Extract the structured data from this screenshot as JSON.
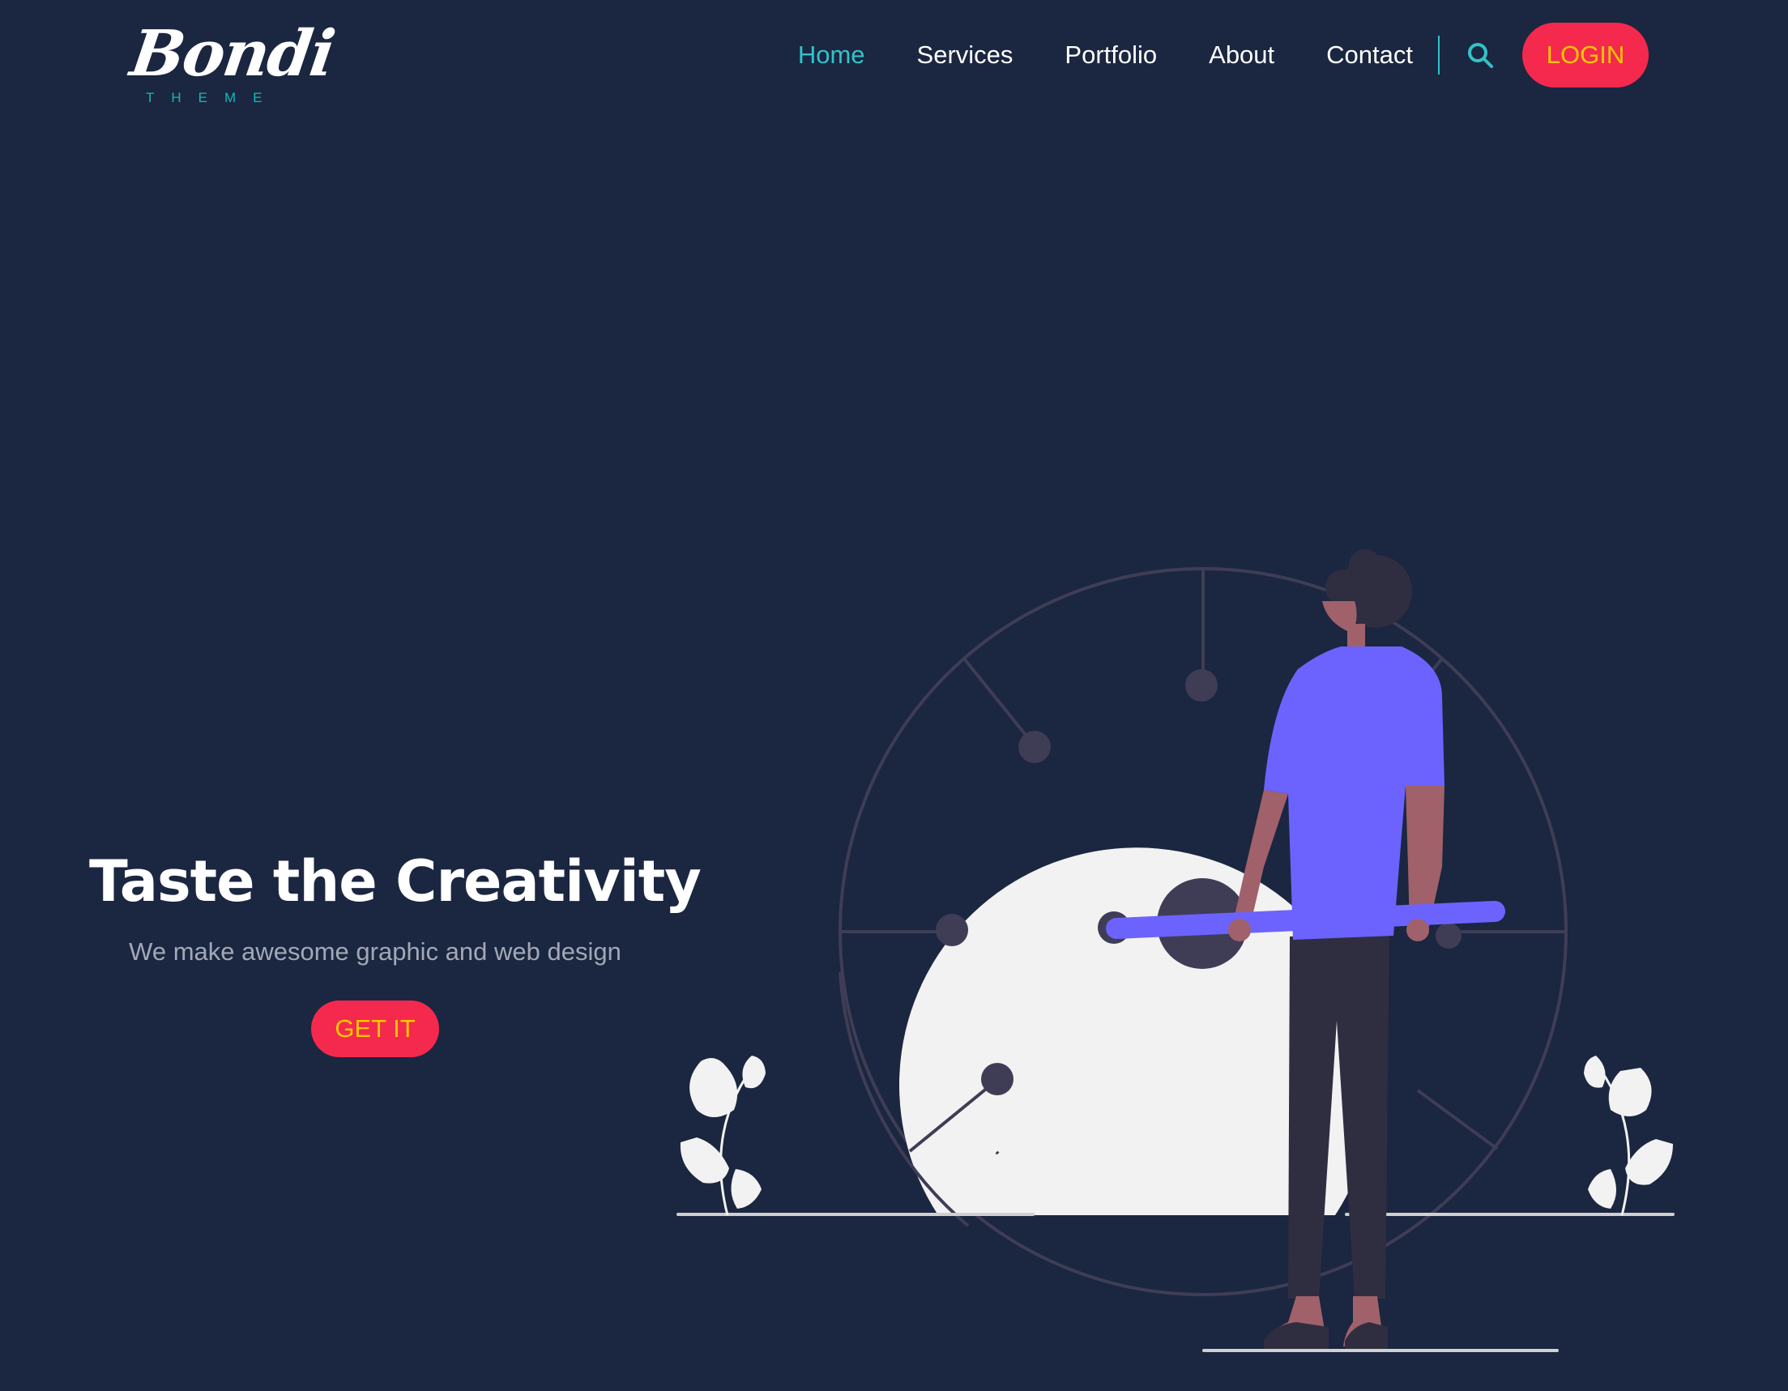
{
  "brand": {
    "logo_text": "Bondi",
    "logo_sub": "THEME",
    "logo_color": "#ffffff",
    "accent_color": "#31c3c9"
  },
  "nav": {
    "items": [
      {
        "label": "Home",
        "active": true
      },
      {
        "label": "Services",
        "active": false
      },
      {
        "label": "Portfolio",
        "active": false
      },
      {
        "label": "About",
        "active": false
      },
      {
        "label": "Contact",
        "active": false
      }
    ],
    "search_icon": "search-icon",
    "login_label": "LOGIN"
  },
  "hero": {
    "title": "Taste the Creativity",
    "subtitle": "We make awesome graphic and web design",
    "cta_label": "GET IT"
  },
  "colors": {
    "background": "#1b2640",
    "cta_background": "#f5294e",
    "cta_text": "#ffc800",
    "illustration_primary": "#6c63ff",
    "illustration_dark": "#3f3d56",
    "illustration_light": "#f2f2f2"
  }
}
